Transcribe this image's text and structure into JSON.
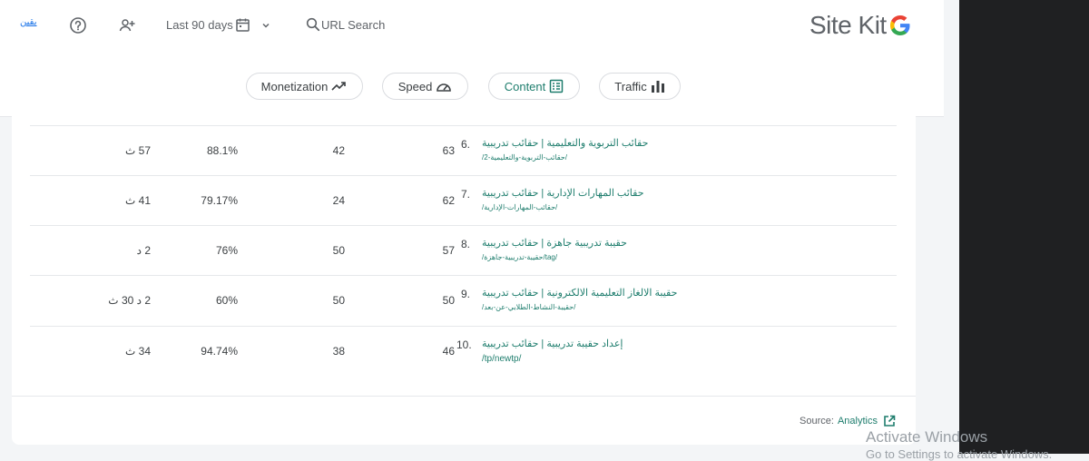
{
  "header": {
    "user_label": "يقين",
    "date_range": "Last 90 days",
    "url_search": "URL Search",
    "logo_text": "Site Kit"
  },
  "icons": {
    "help": "help-circle-icon",
    "add_user": "person-add-icon",
    "calendar": "calendar-icon",
    "chevron": "chevron-down-icon",
    "search": "search-icon",
    "external": "external-link-icon"
  },
  "pills": [
    {
      "label": "Monetization",
      "icon": "trending-up-icon"
    },
    {
      "label": "Speed",
      "icon": "speedometer-icon"
    },
    {
      "label": "Content",
      "icon": "list-alt-icon"
    },
    {
      "label": "Traffic",
      "icon": "bar-chart-icon"
    }
  ],
  "rows": [
    {
      "num": "6.",
      "title": "حقائب التربوية والتعليمية | حقائب تدريبية",
      "path": "/حقائب-التربوية-والتعليمية-2/",
      "rank": "63",
      "views": "42",
      "rate": "88.1%",
      "duration": "57 ث"
    },
    {
      "num": "7.",
      "title": "حقائب المهارات الإدارية | حقائب تدريبية",
      "path": "/حقائب-المهارات-الإدارية/",
      "rank": "62",
      "views": "24",
      "rate": "79.17%",
      "duration": "41 ث"
    },
    {
      "num": "8.",
      "title": "حقيبة تدريبية جاهزة | حقائب تدريبية",
      "path": "/tag/حقيبة-تدريبية-جاهزة/",
      "rank": "57",
      "views": "50",
      "rate": "76%",
      "duration": "2 د"
    },
    {
      "num": "9.",
      "title": "حقيبة الالغاز التعليمية الالكترونية | حقائب تدريبية",
      "path": "/حقيبة-النشاط-الطلابي-عن-بعد/",
      "rank": "50",
      "views": "50",
      "rate": "60%",
      "duration": "2 د 30 ث"
    },
    {
      "num": "10.",
      "title": "إعداد حقيبة تدريبية | حقائب تدريبية",
      "path": "/tp/newtp/",
      "rank": "46",
      "views": "38",
      "rate": "94.74%",
      "duration": "34 ث"
    }
  ],
  "footer": {
    "source_label": "Source:",
    "source_link": "Analytics"
  },
  "watermark": {
    "line1": "Activate Windows",
    "line2": "Go to Settings to activate Windows."
  },
  "colors": {
    "accent": "#1e7d6d",
    "link_blue": "#1a73e8",
    "background": "#f3f5f7"
  }
}
